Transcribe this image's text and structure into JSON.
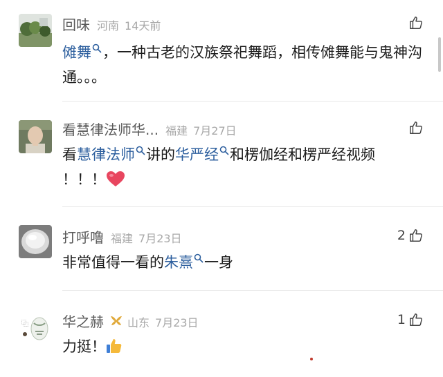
{
  "comments": [
    {
      "name": "回味",
      "region": "河南",
      "time": "14天前",
      "likes": "",
      "avatar": "landscape-avatar",
      "content": {
        "kw1": "傩舞",
        "t1": "，一种古老的汉族祭祀舞蹈，相传傩舞能与鬼神沟通。。。"
      }
    },
    {
      "name": "看慧律法师华...",
      "region": "福建",
      "time": "7月27日",
      "likes": "",
      "avatar": "monk-avatar",
      "content": {
        "t0": "看",
        "kw1": "慧律法师",
        "t1": "讲的",
        "kw2": "华严经",
        "t2": "和楞伽经和楞严经视频",
        "t3": "！！！",
        "emoji": "heart-emoji"
      }
    },
    {
      "name": "打呼噜",
      "region": "福建",
      "time": "7月23日",
      "likes": "2",
      "avatar": "bowl-avatar",
      "content": {
        "t0": "非常值得一看的",
        "kw1": "朱熹",
        "t1": "一身"
      }
    },
    {
      "name": "华之赫",
      "region": "山东",
      "time": "7月23日",
      "likes": "1",
      "avatar": "vase-avatar",
      "badge": "gold-badge-icon",
      "content": {
        "t0": "力挺！",
        "emoji": "thumbs-up-emoji"
      }
    }
  ],
  "colors": {
    "keyword": "#2d5f9e",
    "meta": "#a8a8a8",
    "name": "#5a5a5a",
    "heart": "#e8465f",
    "badge": "#e0a93a"
  }
}
